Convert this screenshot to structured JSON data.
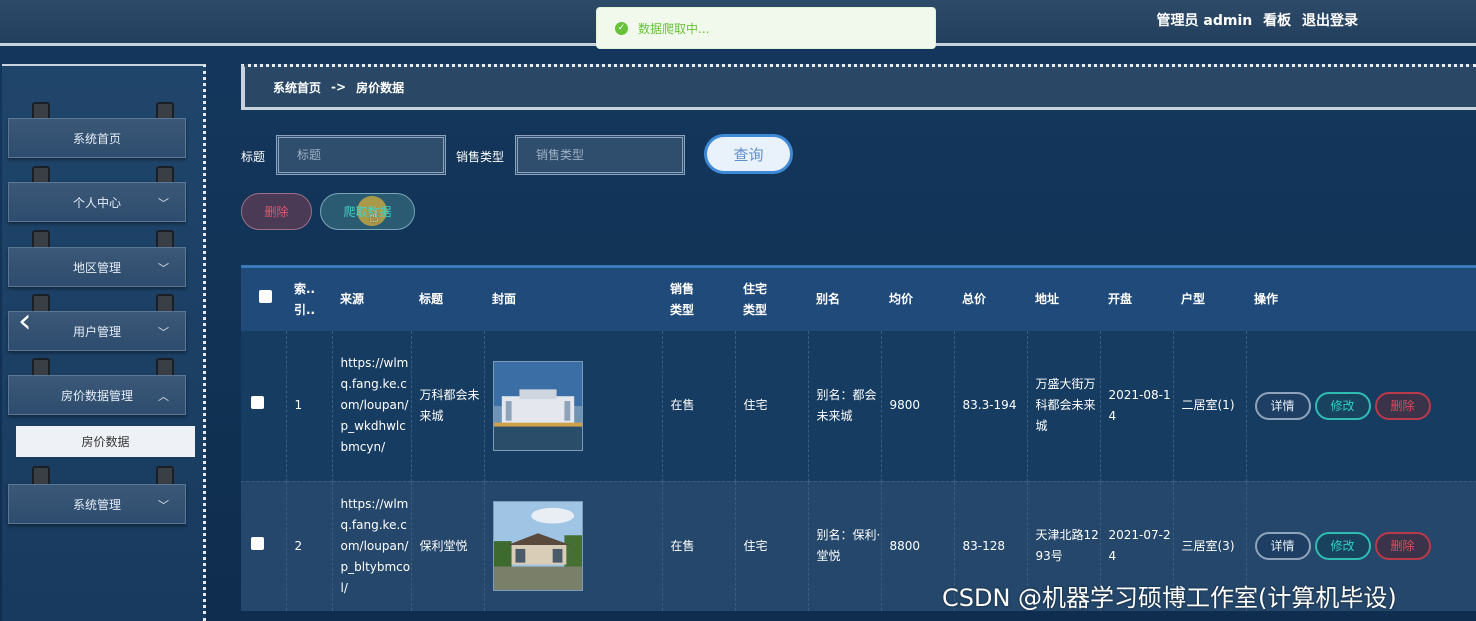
{
  "topbar": {
    "user_label": "管理员 admin",
    "board_link": "看板",
    "logout_link": "退出登录"
  },
  "toast": {
    "message": "数据爬取中..."
  },
  "sidebar": {
    "items": [
      {
        "label": "系统首页",
        "has_chevron": false
      },
      {
        "label": "个人中心",
        "has_chevron": true,
        "chevron": "﹀"
      },
      {
        "label": "地区管理",
        "has_chevron": true,
        "chevron": "﹀"
      },
      {
        "label": "用户管理",
        "has_chevron": true,
        "chevron": "﹀"
      },
      {
        "label": "房价数据管理",
        "has_chevron": true,
        "chevron": "︿"
      },
      {
        "label": "系统管理",
        "has_chevron": true,
        "chevron": "﹀"
      }
    ],
    "sub_item": "房价数据",
    "collapse_arrow": "‹"
  },
  "breadcrumb": {
    "home": "系统首页",
    "separator": "->",
    "current": "房价数据"
  },
  "search": {
    "title_label": "标题",
    "title_placeholder": "标题",
    "sale_type_label": "销售类型",
    "sale_type_placeholder": "销售类型",
    "query_button": "查询"
  },
  "actions": {
    "delete_button": "删除",
    "crawl_button": "爬取数据"
  },
  "table": {
    "headers": {
      "index": [
        "索..",
        "引.."
      ],
      "source": "来源",
      "title": "标题",
      "cover": "封面",
      "sale_type": [
        "销售",
        "类型"
      ],
      "house_type": [
        "住宅",
        "类型"
      ],
      "alias": "别名",
      "avg_price": "均价",
      "total_price": "总价",
      "address": "地址",
      "opening": "开盘",
      "layout": "户型",
      "operation": "操作"
    },
    "rows": [
      {
        "index": "1",
        "source": "https://wlmq.fang.ke.com/loupan/p_wkdhwlcbmcyn/",
        "title": "万科都会未来城",
        "sale_type": "在售",
        "house_type": "住宅",
        "alias": "别名：都会未来城",
        "avg_price": "9800",
        "total_price": "83.3-194",
        "address": "万盛大街万科都会未来城",
        "opening": "2021-08-14",
        "layout": "二居室(1)"
      },
      {
        "index": "2",
        "source": "https://wlmq.fang.ke.com/loupan/p_bltybmcol/",
        "title": "保利堂悦",
        "sale_type": "在售",
        "house_type": "住宅",
        "alias": "别名：保利·堂悦",
        "avg_price": "8800",
        "total_price": "83-128",
        "address": "天津北路1293号",
        "opening": "2021-07-24",
        "layout": "三居室(3)"
      }
    ],
    "op_detail": "详情",
    "op_edit": "修改",
    "op_delete": "删除"
  },
  "watermark": "CSDN @机器学习硕博工作室(计算机毕设)"
}
